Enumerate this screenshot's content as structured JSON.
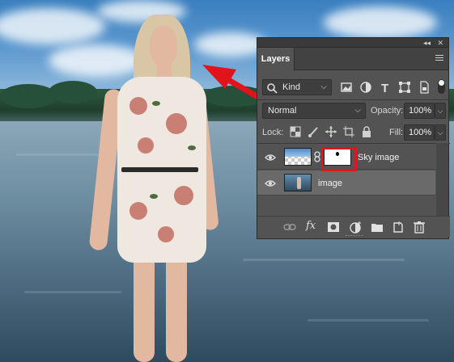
{
  "panel": {
    "tab_label": "Layers",
    "collapse_glyph": "◂◂",
    "close_glyph": "✕",
    "filter": {
      "kind_label": "Kind"
    },
    "blend": {
      "mode": "Normal",
      "opacity_label": "Opacity:",
      "opacity_value": "100%"
    },
    "lock": {
      "label": "Lock:",
      "fill_label": "Fill:",
      "fill_value": "100%"
    },
    "layers": [
      {
        "name": "Sky image",
        "selected": false
      },
      {
        "name": "image",
        "selected": true
      }
    ],
    "bottom_icon_fx": "fx"
  },
  "colors": {
    "panel_bg": "#535353",
    "selected_row": "#6a6a6a",
    "annotation_red": "#e0141b"
  }
}
